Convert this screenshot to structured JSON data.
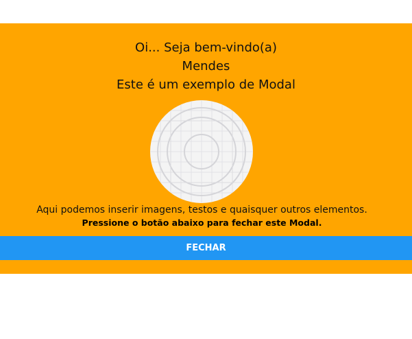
{
  "modal": {
    "greeting_line1": "Oi... Seja bem-vindo(a)",
    "greeting_name": "Mendes",
    "greeting_line3": "Este é um exemplo de Modal",
    "image_icon": "image-placeholder-icon",
    "description": "Aqui podemos inserir imagens, testos e quaisquer outros elementos.",
    "instruction": "Pressione o botão abaixo para fechar este Modal.",
    "close_label": "FECHAR"
  },
  "colors": {
    "modal_background": "#ffa500",
    "button_background": "#2196f3",
    "button_text": "#ffffff"
  }
}
